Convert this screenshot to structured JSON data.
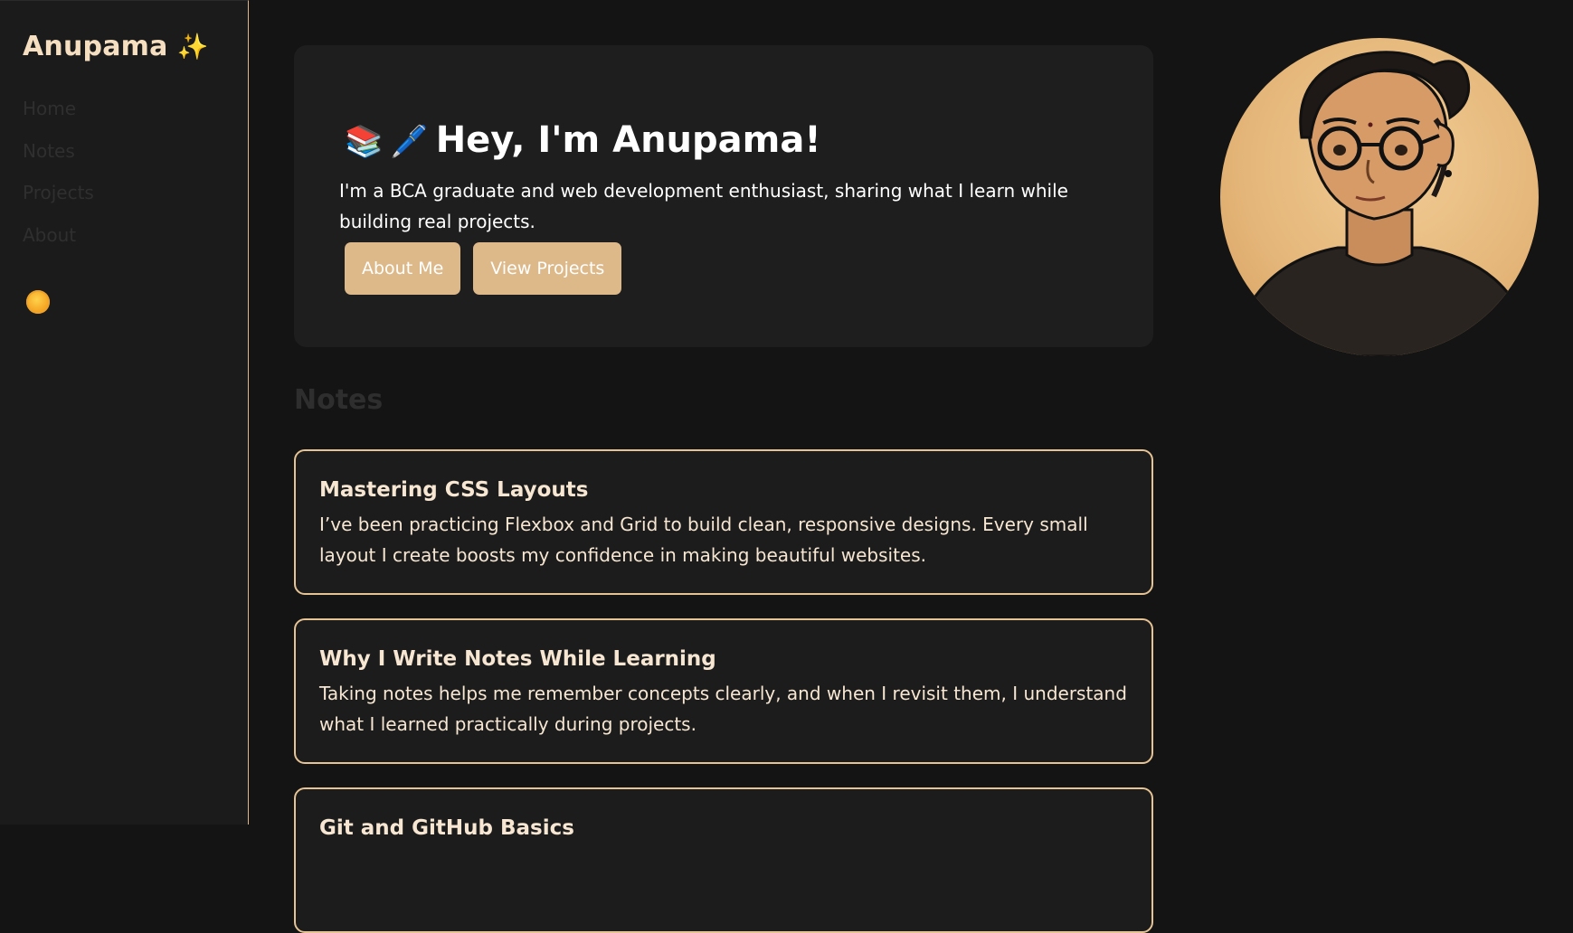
{
  "brand": {
    "name": "Anupama",
    "icon": "sparkles-icon",
    "glyph": "✨"
  },
  "nav": {
    "items": [
      {
        "label": "Home"
      },
      {
        "label": "Notes"
      },
      {
        "label": "Projects"
      },
      {
        "label": "About"
      }
    ]
  },
  "theme_toggle": {
    "icon": "sun-icon"
  },
  "hero": {
    "emoji_books": "📚",
    "emoji_pen": "🖊️",
    "title": "Hey, I'm Anupama!",
    "description": "I'm a BCA graduate and web development enthusiast, sharing what I learn while building real projects.",
    "buttons": {
      "about": "About Me",
      "projects": "View Projects"
    }
  },
  "notes_section": {
    "title": "Notes",
    "items": [
      {
        "title": "Mastering CSS Layouts",
        "body": "I’ve been practicing Flexbox and Grid to build clean, responsive designs. Every small layout I create boosts my confidence in making beautiful websites."
      },
      {
        "title": "Why I Write Notes While Learning",
        "body": "Taking notes helps me remember concepts clearly, and when I revisit them, I understand what I learned practically during projects."
      },
      {
        "title": "Git and GitHub Basics",
        "body": ""
      }
    ]
  },
  "colors": {
    "accent": "#ddb98a",
    "background": "#141414",
    "sidebar": "#1b1b1b",
    "card": "#1e1e1e"
  }
}
